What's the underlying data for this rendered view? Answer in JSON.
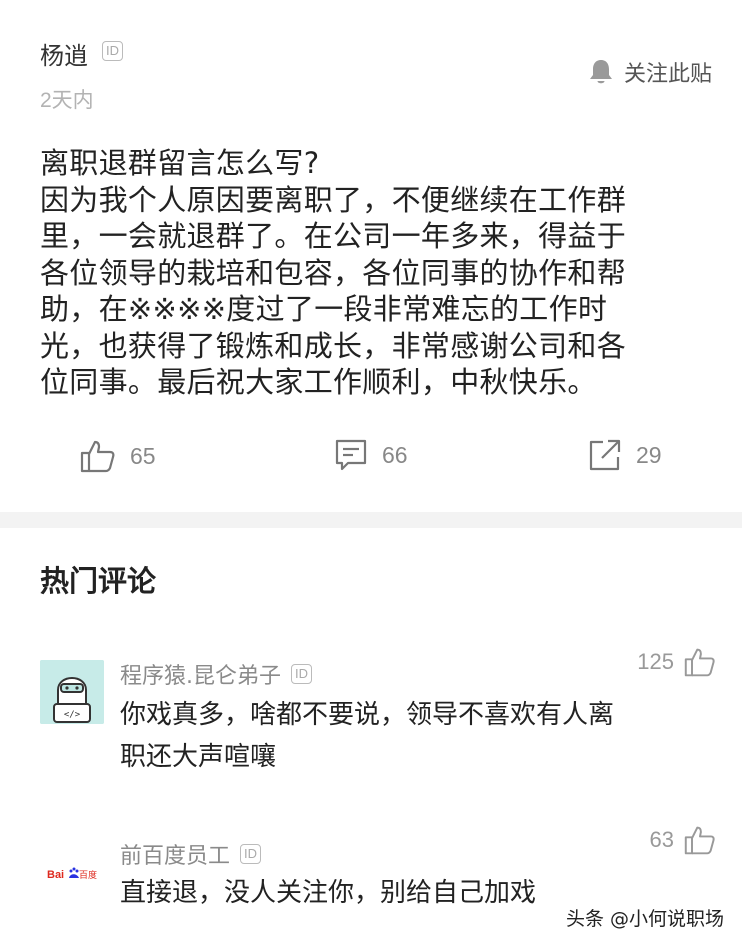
{
  "post": {
    "author": "杨逍",
    "id_badge": "ID",
    "follow_label": "关注此贴",
    "time": "2天内",
    "body_lines": [
      "离职退群留言怎么写?",
      "因为我个人原因要离职了，不便继续在工作群",
      "里，一会就退群了。在公司一年多来，得益于",
      "各位领导的栽培和包容，各位同事的协作和帮",
      "助，在※※※※度过了一段非常难忘的工作时",
      "光，也获得了锻炼和成长，非常感谢公司和各",
      "位同事。最后祝大家工作顺利，中秋快乐。"
    ],
    "likes": "65",
    "comments": "66",
    "shares": "29"
  },
  "hot_comments": {
    "title": "热门评论",
    "items": [
      {
        "user": "程序猿.昆仑弟子",
        "id_badge": "ID",
        "likes": "125",
        "lines": [
          "你戏真多，啥都不要说，领导不喜欢有人离",
          "职还大声喧嚷"
        ],
        "avatar_text": "</>"
      },
      {
        "user": "前百度员工",
        "id_badge": "ID",
        "likes": "63",
        "lines": [
          "直接退，没人关注你，别给自己加戏"
        ],
        "avatar_text": "Bai百度"
      }
    ]
  },
  "watermark": "头条 @小何说职场",
  "icons": [
    "bell-icon",
    "thumbs-up-icon",
    "comment-icon",
    "share-icon"
  ],
  "colors": {
    "divider": "#f3f3f3",
    "avatar_bg": "#c7ebe8",
    "baidu_red": "#de2a1f",
    "baidu_blue": "#2932e1"
  }
}
